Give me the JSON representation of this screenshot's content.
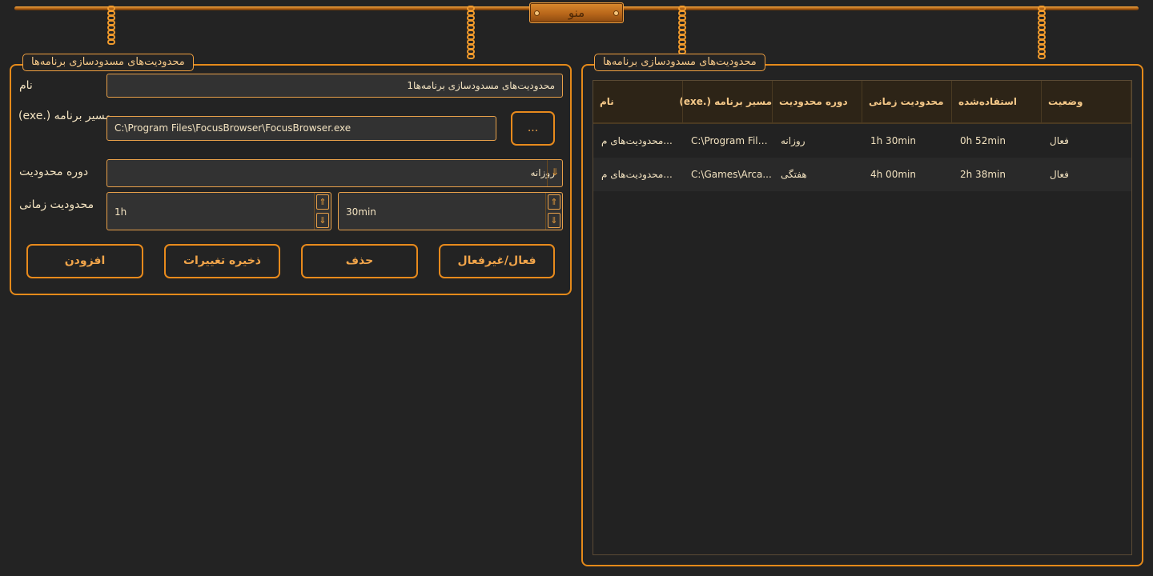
{
  "menu": {
    "label": "منو"
  },
  "left_panel": {
    "title": "محدودیت‌های مسدودسازی برنامه‌ها",
    "name_label": "نام",
    "name_value": "محدودیت‌های مسدودسازی برنامه‌ها1",
    "path_label": "مسیر برنامه (.exe)",
    "path_value": "C:\\Program Files\\FocusBrowser\\FocusBrowser.exe",
    "browse_label": "...",
    "period_label": "دوره محدودیت",
    "period_value": "روزانه",
    "time_label": "محدودیت زمانی",
    "hours_value": "1h",
    "minutes_value": "30min",
    "buttons": {
      "toggle": "فعال/غیرفعال",
      "delete": "حذف",
      "save": "ذخیره تغییرات",
      "add": "افزودن"
    }
  },
  "right_panel": {
    "title": "محدودیت‌های مسدودسازی برنامه‌ها",
    "columns": [
      "وضعیت",
      "استفاده‌شده",
      "محدودیت زمانی",
      "دوره محدودیت",
      "مسیر برنامه (.exe)",
      "نام"
    ],
    "rows": [
      {
        "status": "فعال",
        "used": "0h 52min",
        "limit": "1h 30min",
        "period": "روزانه",
        "path": "C:\\Program File...",
        "name": "...محدودیت‌های م"
      },
      {
        "status": "فعال",
        "used": "2h 38min",
        "limit": "4h 00min",
        "period": "هفتگی",
        "path": "C:\\Games\\Arca...",
        "name": "...محدودیت‌های م"
      }
    ]
  },
  "colors": {
    "accent": "#e88a1c",
    "background": "#232323",
    "text": "#f2e2c0"
  }
}
